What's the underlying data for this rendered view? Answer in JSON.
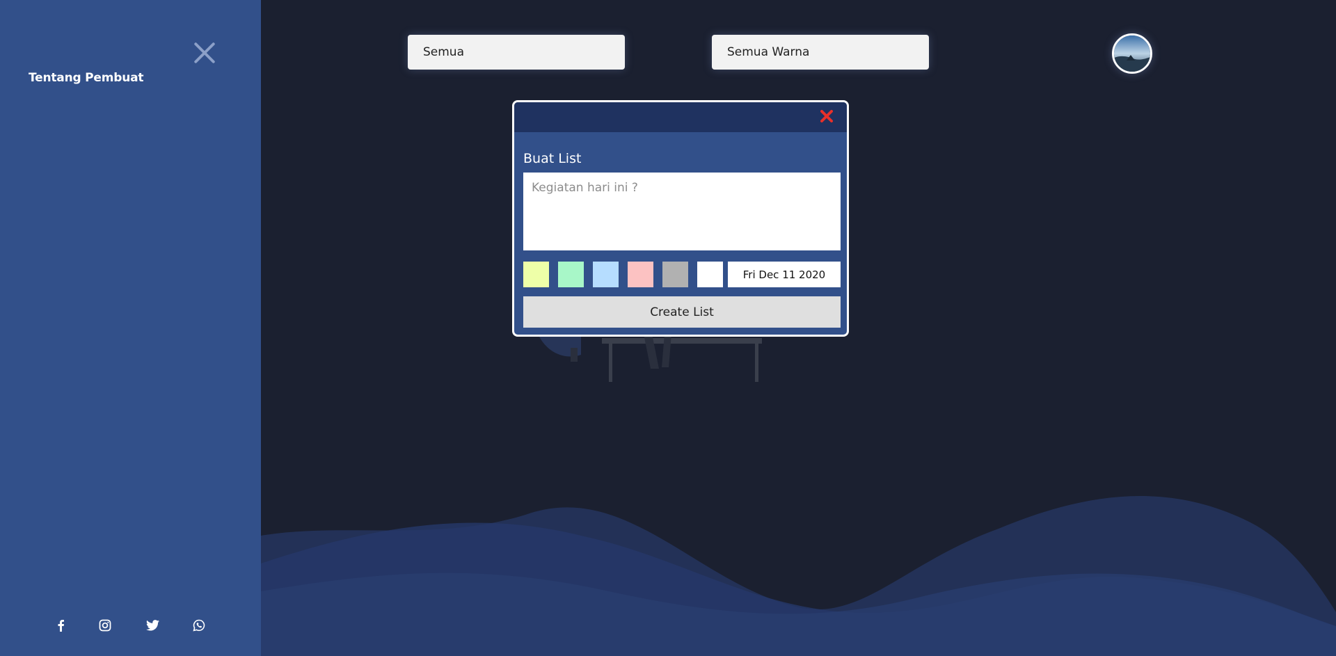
{
  "sidebar": {
    "close_icon": "close-icon",
    "link_label": "Tentang Pembuat",
    "social": [
      {
        "icon": "facebook-icon"
      },
      {
        "icon": "instagram-icon"
      },
      {
        "icon": "twitter-icon"
      },
      {
        "icon": "whatsapp-icon"
      }
    ]
  },
  "filters": {
    "category_value": "Semua",
    "color_value": "Semua Warna"
  },
  "modal": {
    "title": "Buat List",
    "textarea_placeholder": "Kegiatan hari ini ?",
    "swatches": [
      "#eeffa8",
      "#a8f7c8",
      "#b6ddff",
      "#fcc2c2",
      "#b1b1b1",
      "#ffffff"
    ],
    "date": "Fri Dec 11 2020",
    "create_label": "Create List",
    "close_color": "#e8302a"
  },
  "colors": {
    "sidebar_bg": "#32508a",
    "main_bg": "#1b2030",
    "modal_header": "#1f3260"
  }
}
